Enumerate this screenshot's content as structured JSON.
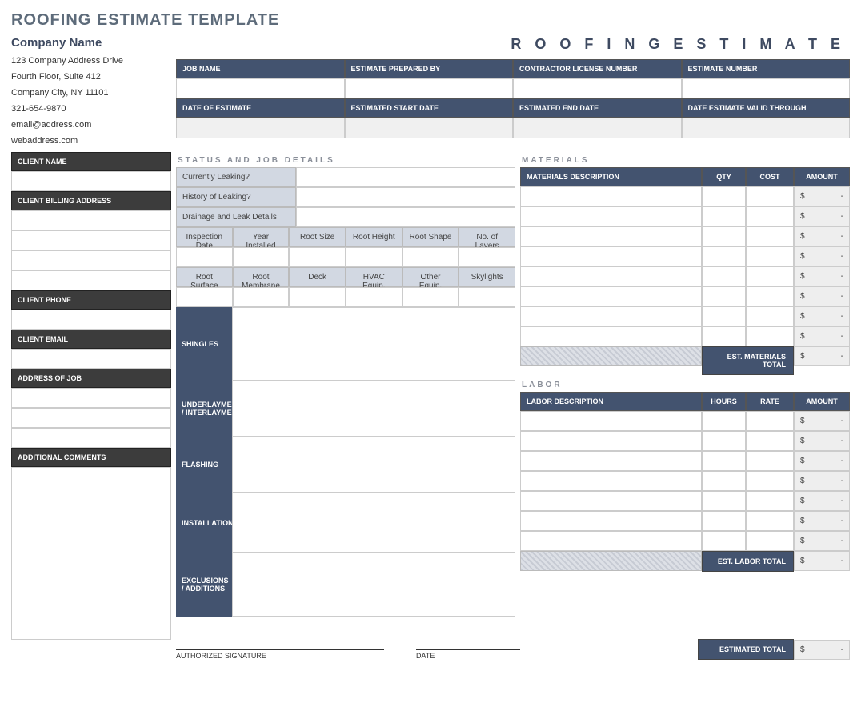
{
  "title": "ROOFING ESTIMATE TEMPLATE",
  "rightTitle": "R O O F I N G   E S T I M A T E",
  "company": {
    "name": "Company Name",
    "addr1": "123 Company Address Drive",
    "addr2": "Fourth Floor, Suite 412",
    "addr3": "Company City, NY  11101",
    "phone": "321-654-9870",
    "email": "email@address.com",
    "web": "webaddress.com"
  },
  "client": {
    "nameLabel": "CLIENT NAME",
    "billingLabel": "CLIENT BILLING ADDRESS",
    "phoneLabel": "CLIENT PHONE",
    "emailLabel": "CLIENT EMAIL",
    "jobAddrLabel": "ADDRESS OF JOB",
    "commentsLabel": "ADDITIONAL COMMENTS"
  },
  "topHeaders": {
    "row1": [
      "JOB NAME",
      "ESTIMATE PREPARED BY",
      "CONTRACTOR LICENSE NUMBER",
      "ESTIMATE NUMBER"
    ],
    "row2": [
      "DATE OF ESTIMATE",
      "ESTIMATED START DATE",
      "ESTIMATED END DATE",
      "DATE ESTIMATE VALID THROUGH"
    ]
  },
  "sections": {
    "status": "STATUS  AND  JOB  DETAILS",
    "materials": "MATERIALS",
    "labor": "LABOR"
  },
  "status": {
    "leaking": "Currently Leaking?",
    "history": "History of Leaking?",
    "drainage": "Drainage and Leak Details",
    "detailRow1": [
      "Inspection Date",
      "Year Installed",
      "Root Size",
      "Root Height",
      "Root Shape",
      "No. of Layers"
    ],
    "detailRow2": [
      "Root Surface",
      "Root Membrane",
      "Deck",
      "HVAC Equip.",
      "Other Equip.",
      "Skylights"
    ],
    "sideLabels": [
      "SHINGLES",
      "UNDERLAYMENT / INTERLAYMENT",
      "FLASHING",
      "INSTALLATION",
      "EXCLUSIONS / ADDITIONS"
    ]
  },
  "materials": {
    "headers": [
      "MATERIALS DESCRIPTION",
      "QTY",
      "COST",
      "AMOUNT"
    ],
    "totalLabel": "EST. MATERIALS  TOTAL",
    "amount": {
      "sym": "$",
      "dash": "-"
    }
  },
  "labor": {
    "headers": [
      "LABOR DESCRIPTION",
      "HOURS",
      "RATE",
      "AMOUNT"
    ],
    "totalLabel": "EST. LABOR TOTAL"
  },
  "footer": {
    "sig": "AUTHORIZED SIGNATURE",
    "date": "DATE",
    "totalLabel": "ESTIMATED TOTAL"
  }
}
